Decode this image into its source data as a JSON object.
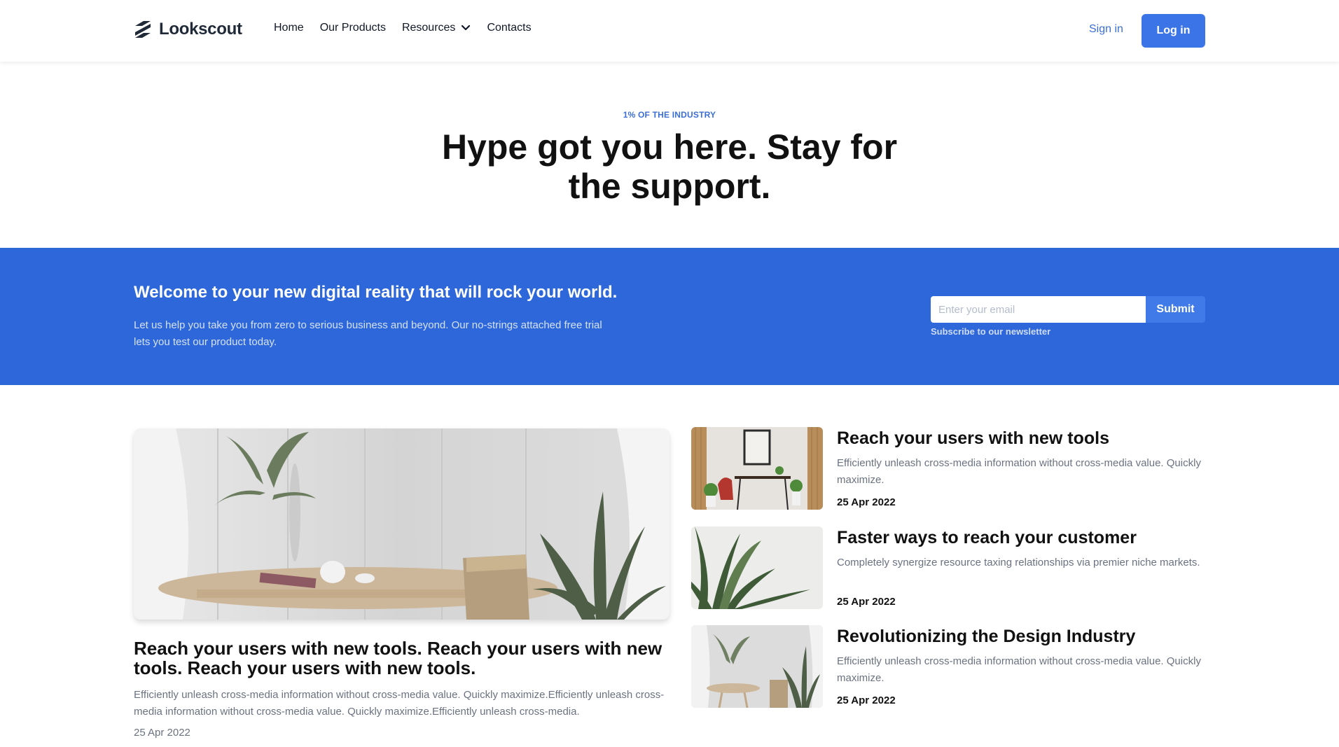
{
  "header": {
    "brand": "Lookscout",
    "nav": [
      {
        "label": "Home"
      },
      {
        "label": "Our Products"
      },
      {
        "label": "Resources",
        "icon": "chevron-down-icon"
      },
      {
        "label": "Contacts"
      }
    ],
    "sign_in": "Sign in",
    "log_in": "Log in"
  },
  "hero": {
    "eyebrow": "1% OF THE INDUSTRY",
    "title": "Hype got you here. Stay for the support."
  },
  "banner": {
    "title": "Welcome to your new digital reality that will rock your world.",
    "text": "Let us help you take you from zero to serious business and beyond. Our no-strings attached free trial lets you test our product today.",
    "email_placeholder": "Enter your email",
    "submit": "Submit",
    "note": "Subscribe to our newsletter"
  },
  "featured": {
    "title": "Reach your users with new tools. Reach your users with new tools. Reach your users with new tools.",
    "text": "Efficiently unleash cross-media information without cross-media value. Quickly maximize.Efficiently unleash cross-media information without cross-media value. Quickly maximize.Efficiently unleash cross-media.",
    "date": "25 Apr 2022"
  },
  "articles": [
    {
      "title": "Reach your users with new tools",
      "text": "Efficiently unleash cross-media information without cross-media value. Quickly maximize.",
      "date": "25 Apr 2022"
    },
    {
      "title": "Faster ways to reach your customer",
      "text": "Completely synergize resource taxing relationships via premier niche markets.",
      "date": "25 Apr 2022"
    },
    {
      "title": "Revolutionizing the Design Industry",
      "text": "Efficiently unleash cross-media information without cross-media value. Quickly maximize.",
      "date": "25 Apr 2022"
    }
  ],
  "colors": {
    "primary": "#3b74e6",
    "banner": "#2d67d9",
    "link": "#3b6fd6"
  }
}
